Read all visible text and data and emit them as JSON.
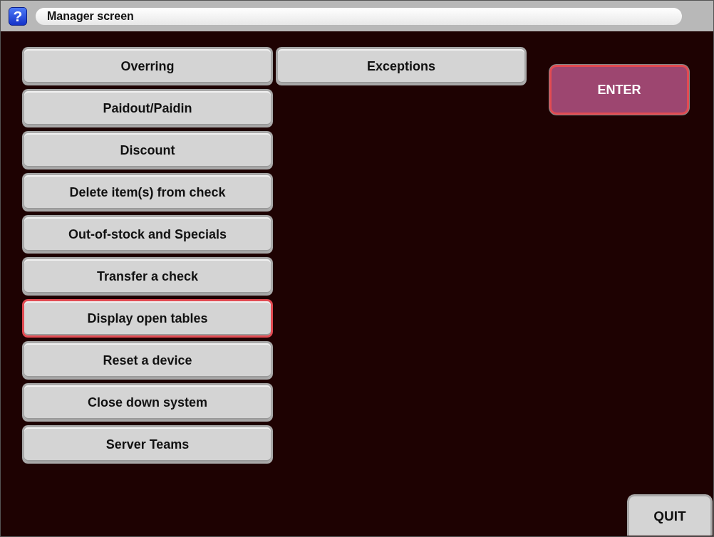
{
  "window": {
    "help": "?",
    "title": "Manager screen"
  },
  "columns": [
    [
      {
        "label": "Overring",
        "selected": false
      },
      {
        "label": "Paidout/Paidin",
        "selected": false
      },
      {
        "label": "Discount",
        "selected": false
      },
      {
        "label": "Delete item(s) from check",
        "selected": false
      },
      {
        "label": "Out-of-stock and Specials",
        "selected": false
      },
      {
        "label": "Transfer a check",
        "selected": false
      },
      {
        "label": "Display open tables",
        "selected": true
      },
      {
        "label": "Reset a device",
        "selected": false
      },
      {
        "label": "Close down system",
        "selected": false
      },
      {
        "label": "Server Teams",
        "selected": false
      }
    ],
    [
      {
        "label": "Exceptions",
        "selected": false
      }
    ]
  ],
  "enter": {
    "label": "ENTER",
    "selected": true
  },
  "quit": {
    "label": "QUIT"
  }
}
